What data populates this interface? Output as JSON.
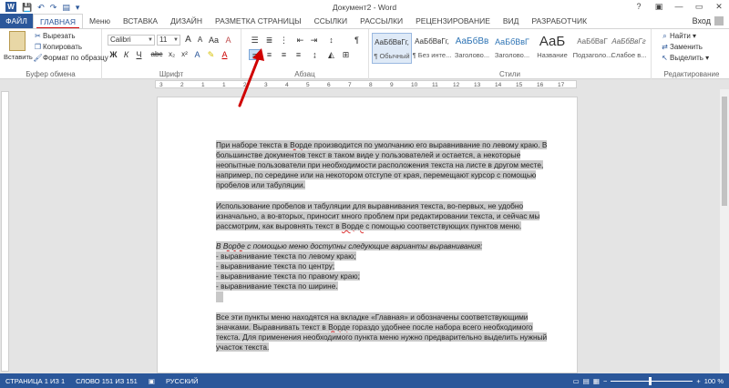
{
  "titlebar": {
    "title": "Документ2 - Word",
    "help": "?",
    "minimize": "—",
    "restore": "▭",
    "close": "✕"
  },
  "tabs": {
    "file": "ФАЙЛ",
    "items": [
      "ГЛАВНАЯ",
      "Меню",
      "ВСТАВКА",
      "ДИЗАЙН",
      "РАЗМЕТКА СТРАНИЦЫ",
      "ССЫЛКИ",
      "РАССЫЛКИ",
      "РЕЦЕНЗИРОВАНИЕ",
      "ВИД",
      "РАЗРАБОТЧИК"
    ],
    "active": "ГЛАВНАЯ",
    "signin": "Вход"
  },
  "clipboard": {
    "paste": "Вставить",
    "cut": "Вырезать",
    "copy": "Копировать",
    "format_painter": "Формат по образцу",
    "label": "Буфер обмена"
  },
  "font": {
    "name": "Calibri",
    "size": "11",
    "bold": "Ж",
    "italic": "К",
    "underline": "Ч",
    "strike": "abc",
    "sub": "x₂",
    "sup": "x²",
    "grow": "A",
    "shrink": "A",
    "case": "Aa",
    "clear": "A",
    "label": "Шрифт"
  },
  "paragraph": {
    "label": "Абзац",
    "show_marks": "¶"
  },
  "styles": {
    "label": "Стили",
    "items": [
      {
        "sample": "АаБбВвГг,",
        "name": "¶ Обычный"
      },
      {
        "sample": "АаБбВвГг,",
        "name": "¶ Без инте..."
      },
      {
        "sample": "АаБбВв",
        "name": "Заголово..."
      },
      {
        "sample": "АаБбВвГ",
        "name": "Заголово..."
      },
      {
        "sample": "АаБ",
        "name": "Название"
      },
      {
        "sample": "АаБбВвГ",
        "name": "Подзаголо..."
      },
      {
        "sample": "АаБбВвГг",
        "name": "Слабое в..."
      }
    ]
  },
  "editing": {
    "find": "Найти",
    "replace": "Заменить",
    "select": "Выделить",
    "label": "Редактирование"
  },
  "ruler": {
    "numbers": [
      "3",
      "2",
      "1",
      "1",
      "2",
      "3",
      "4",
      "5",
      "6",
      "7",
      "8",
      "9",
      "10",
      "11",
      "12",
      "13",
      "14",
      "15",
      "16",
      "17"
    ]
  },
  "document": {
    "p1_a": "При наборе текста в ",
    "p1_word": "Ворде",
    "p1_b": " производится по умолчанию его выравнивание по левому краю. В большинстве документов текст в таком виде у пользователей и остается, а некоторые неопытные пользователи при необходимости расположения текста на листе в другом месте, например, по середине или на некотором отступе от края, перемещают курсор с помощью пробелов или табуляции.",
    "p2_a": "Использование пробелов и табуляции для выравнивания текста, во-первых, не удобно изначально, а во-вторых, приносит много проблем при редактировании текста, и сейчас мы рассмотрим, как выровнять текст в ",
    "p2_word": "Ворде",
    "p2_b": " с помощью соответствующих пунктов меню.",
    "p3_head_a": "В ",
    "p3_head_word": "Ворде",
    "p3_head_b": " с помощью меню доступны следующие варианты выравнивания:",
    "p3_items": [
      "- выравнивание текста по левому краю;",
      "- выравнивание текста по центру;",
      "- выравнивание текста по правому краю;",
      "- выравнивание текста по ширине."
    ],
    "p4_a": "Все эти пункты меню находятся на вкладке «Главная» и обозначены соответствующими значками. Выравнивать текст в ",
    "p4_word": "Ворде",
    "p4_b": " гораздо удобнее после набора всего необходимого текста. Для применения необходимого пункта меню нужно предварительно выделить нужный участок текста."
  },
  "status": {
    "page": "СТРАНИЦА 1 ИЗ 1",
    "words": "СЛОВО 151 ИЗ 151",
    "lang": "РУССКИЙ",
    "zoom_minus": "−",
    "zoom_plus": "+",
    "zoom": "100 %"
  },
  "colors": {
    "accent": "#2b579a",
    "arrow": "#d00000",
    "selection": "#c8c8c8"
  }
}
